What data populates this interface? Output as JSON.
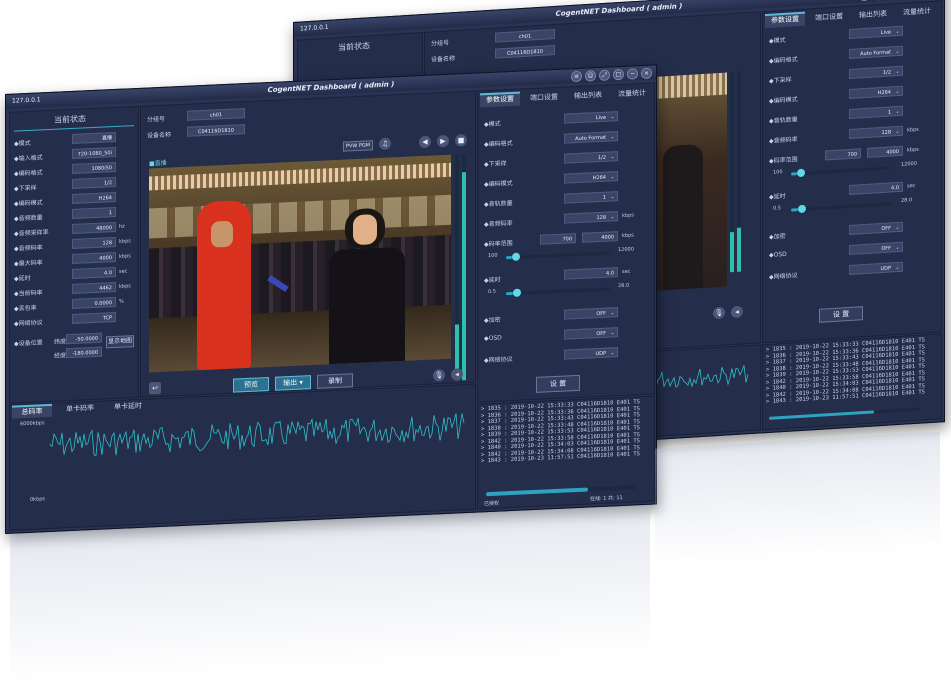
{
  "app": {
    "title": "CogentNET Dashboard ( admin )",
    "ip": "127.0.0.1"
  },
  "left": {
    "header": "当前状态",
    "fields": [
      {
        "label": "◆模式",
        "value": "直播"
      },
      {
        "label": "◆输入格式",
        "value": "720-1080_50i"
      },
      {
        "label": "◆编码格式",
        "value": "1080i50"
      },
      {
        "label": "◆下采样",
        "value": "1/2"
      },
      {
        "label": "◆编码模式",
        "value": "H264"
      },
      {
        "label": "◆音频数量",
        "value": "1"
      },
      {
        "label": "◆音频采样率",
        "value": "48000",
        "unit": "hz"
      },
      {
        "label": "◆音频码率",
        "value": "128",
        "unit": "kbps"
      },
      {
        "label": "◆最大码率",
        "value": "4000",
        "unit": "kbps"
      },
      {
        "label": "◆延时",
        "value": "4.0",
        "unit": "sec"
      },
      {
        "label": "◆当前码率",
        "value": "4462",
        "unit": "kbps"
      },
      {
        "label": "◆丢包率",
        "value": "0.0000",
        "unit": "%"
      },
      {
        "label": "◆网络协议",
        "value": "TCP"
      }
    ],
    "location_label": "◆设备位置",
    "lat_label": "纬度",
    "lat_value": "-50.0000",
    "lon_label": "经度",
    "lon_value": "-180.0000",
    "map_button": "显示地图",
    "tabs": [
      "总码率",
      "单卡码率",
      "单卡延时"
    ],
    "chart_top": "6000kbps",
    "chart_bottom": "0kbps"
  },
  "center": {
    "group_label": "分组号",
    "group_value": "ch01",
    "device_label": "设备名称",
    "device_value": "C04116D1810",
    "live_badge": "■直播",
    "pgm_label": "PVW PGM",
    "buttons": {
      "preview": "预览",
      "output": "输出",
      "record": "录制"
    },
    "vu_levels": [
      0.25,
      0.92
    ]
  },
  "right": {
    "tabs": [
      "参数设置",
      "端口设置",
      "输出列表",
      "流量统计"
    ],
    "params": [
      {
        "label": "◆模式",
        "value": "Live"
      },
      {
        "label": "◆编码格式",
        "value": "Auto Format"
      },
      {
        "label": "◆下采样",
        "value": "1/2"
      },
      {
        "label": "◆编码模式",
        "value": "H264"
      },
      {
        "label": "◆音轨数量",
        "value": "1"
      },
      {
        "label": "◆音频码率",
        "value": "128",
        "unit": "kbps"
      }
    ],
    "bitrate": {
      "label": "◆码率范围",
      "min": "700",
      "max": "4000",
      "unit": "kbps",
      "range_min": "100",
      "range_max": "12000",
      "level": 0.06
    },
    "delay": {
      "label": "◆延时",
      "value": "4.0",
      "unit": "sec",
      "range_min": "0.5",
      "range_max": "28.0",
      "level": 0.07
    },
    "flags": [
      {
        "label": "◆加密",
        "value": "OFF"
      },
      {
        "label": "◆OSD",
        "value": "OFF"
      },
      {
        "label": "◆网络协议",
        "value": "UDP"
      }
    ],
    "set_button": "设 置",
    "log_lines": [
      "> 1835 : 2019-10-22 15:33:33 C04116D1810 E401 TS",
      "> 1836 : 2019-10-22 15:33:36 C04116D1810 E401 TS",
      "> 1837 : 2019-10-22 15:33:43 C04116D1810 E401 TS",
      "> 1838 : 2019-10-22 15:33:48 C04116D1810 E401 TS",
      "> 1839 : 2019-10-22 15:33:53 C04116D1810 E401 TS",
      "> 1842 : 2019-10-22 15:33:58 C04116D1810 E401 TS",
      "> 1840 : 2019-10-22 15:34:03 C04116D1810 E401 TS",
      "> 1842 : 2019-10-22 15:34:08 C04116D1810 E401 TS",
      "> 1843 : 2019-10-23 11:57:51 C04116D1810 E401 TS"
    ],
    "status_left": "已授权",
    "status_right": "在线: 1 共: 11"
  },
  "colors": {
    "accent": "#2ea3c0",
    "wave": "#2ec0c8",
    "bg": "#2a3452"
  },
  "icons": [
    "settings-icon",
    "user-icon",
    "expand-icon",
    "restore-icon",
    "minimize-icon",
    "close-icon",
    "speaker-icon",
    "mic-icon",
    "back-icon",
    "prev-icon",
    "play-icon",
    "stop-icon"
  ]
}
